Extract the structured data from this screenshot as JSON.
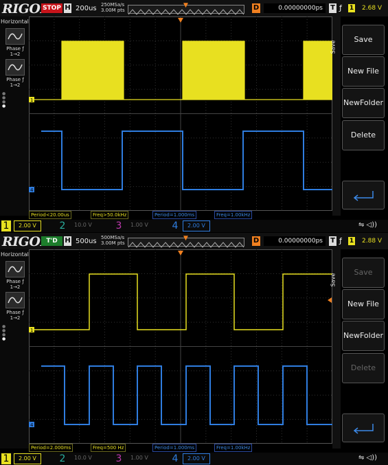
{
  "panels": [
    {
      "logo": "RIGOL",
      "run_status": "STOP",
      "h_label": "H",
      "timebase": "200us",
      "sample_rate": "250MSa/s",
      "mem_depth": "3.00M pts",
      "d_label": "D",
      "delay": "0.00000000ps",
      "t_label": "T",
      "trigger_edge": "ƒ",
      "trigger_channel": "1",
      "trigger_level": "2.68 V",
      "left_menu": {
        "title": "Horizontal",
        "phase_items": [
          {
            "label": "Phase ƒ",
            "sub": "1→2"
          },
          {
            "label": "Phase ƒ",
            "sub": "1→2"
          }
        ]
      },
      "side_tab": "Save",
      "buttons": [
        {
          "label": "Save",
          "enabled": true
        },
        {
          "label": "New File",
          "enabled": true
        },
        {
          "label": "NewFolder",
          "enabled": true
        },
        {
          "label": "Delete",
          "enabled": true
        }
      ],
      "measurements": [
        {
          "text": "Period<20.00us",
          "color": "yellow"
        },
        {
          "text": "Freq>50.0kHz",
          "color": "yellow"
        },
        {
          "text": "Period=1.000ms",
          "color": "blue"
        },
        {
          "text": "Freq=1.00kHz",
          "color": "blue"
        }
      ],
      "channels": [
        {
          "num": "1",
          "scale": "2.00 V",
          "active": true
        },
        {
          "num": "2",
          "scale": "10.0 V",
          "active": false
        },
        {
          "num": "3",
          "scale": "1.00 V",
          "active": false
        },
        {
          "num": "4",
          "scale": "2.00 V",
          "active": true
        }
      ],
      "markers": {
        "ch1": "1",
        "ch4": "4"
      }
    },
    {
      "logo": "RIGOL",
      "run_status": "T'D",
      "h_label": "H",
      "timebase": "500us",
      "sample_rate": "500MSa/s",
      "mem_depth": "3.00M pts",
      "d_label": "D",
      "delay": "0.00000000ps",
      "t_label": "T",
      "trigger_edge": "ƒ",
      "trigger_channel": "1",
      "trigger_level": "2.88 V",
      "left_menu": {
        "title": "Horizontal",
        "phase_items": [
          {
            "label": "Phase ƒ",
            "sub": "1→2"
          },
          {
            "label": "Phase ƒ",
            "sub": "1→2"
          }
        ]
      },
      "side_tab": "Save",
      "buttons": [
        {
          "label": "Save",
          "enabled": false
        },
        {
          "label": "New File",
          "enabled": true
        },
        {
          "label": "NewFolder",
          "enabled": true
        },
        {
          "label": "Delete",
          "enabled": false
        }
      ],
      "measurements": [
        {
          "text": "Period=2.000ms",
          "color": "yellow"
        },
        {
          "text": "Freq=500 Hz",
          "color": "yellow"
        },
        {
          "text": "Period=1.000ms",
          "color": "blue"
        },
        {
          "text": "Freq=1.00kHz",
          "color": "blue"
        }
      ],
      "channels": [
        {
          "num": "1",
          "scale": "2.00 V",
          "active": true
        },
        {
          "num": "2",
          "scale": "10.0 V",
          "active": false
        },
        {
          "num": "3",
          "scale": "1.00 V",
          "active": false
        },
        {
          "num": "4",
          "scale": "2.00 V",
          "active": true
        }
      ],
      "markers": {
        "ch1": "1",
        "ch4": "4"
      }
    }
  ],
  "colors": {
    "ch1": "#e8e020",
    "ch2": "#2ab0a0",
    "ch3": "#c03ab0",
    "ch4": "#2f7de0",
    "grid": "#333333",
    "accent": "#f08020"
  },
  "icons": {
    "phase": "phase-waveform-icon",
    "return": "return-arrow-icon",
    "usb": "usb-icon",
    "speaker": "speaker-icon"
  }
}
